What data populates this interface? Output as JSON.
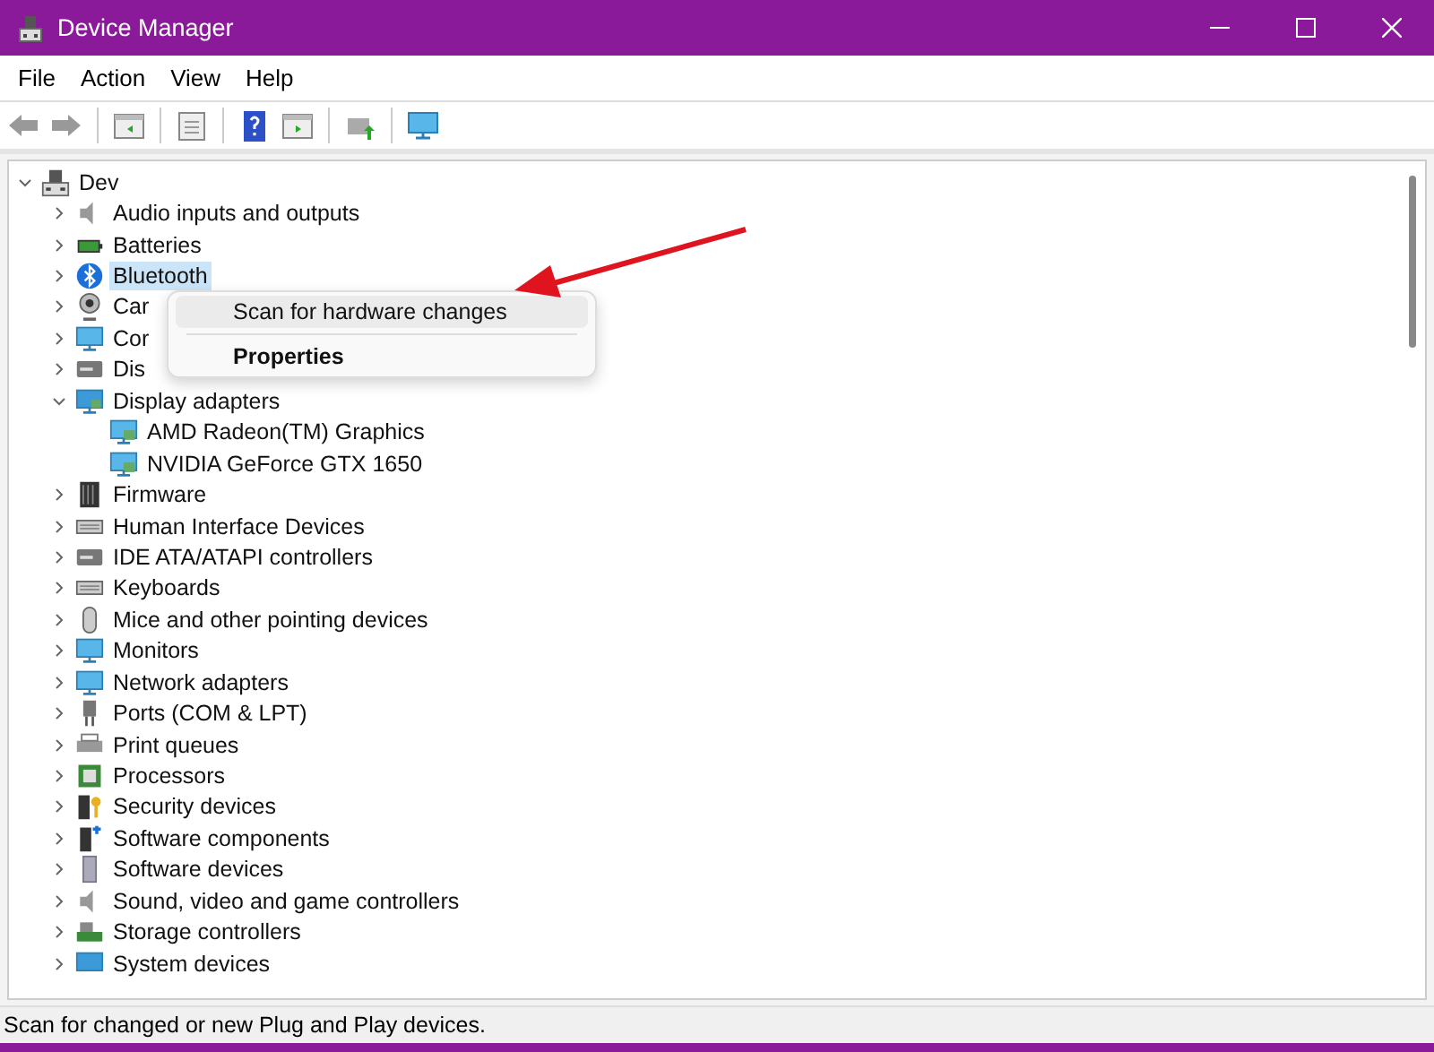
{
  "window": {
    "title": "Device Manager"
  },
  "menu_bar": [
    "File",
    "Action",
    "View",
    "Help"
  ],
  "tree": {
    "label": "Dev",
    "expanded": true,
    "selected": false,
    "children": [
      {
        "label": "Audio inputs and outputs",
        "expanded": false,
        "selected": false
      },
      {
        "label": "Batteries",
        "expanded": false,
        "selected": false
      },
      {
        "label": "Bluetooth",
        "expanded": false,
        "selected": true
      },
      {
        "label": "Car",
        "expanded": false,
        "selected": false
      },
      {
        "label": "Cor",
        "expanded": false,
        "selected": false
      },
      {
        "label": "Dis",
        "expanded": false,
        "selected": false
      },
      {
        "label": "Display adapters",
        "expanded": true,
        "selected": false,
        "children": [
          {
            "label": "AMD Radeon(TM) Graphics",
            "selected": false
          },
          {
            "label": "NVIDIA GeForce GTX 1650",
            "selected": false
          }
        ]
      },
      {
        "label": "Firmware",
        "expanded": false,
        "selected": false
      },
      {
        "label": "Human Interface Devices",
        "expanded": false,
        "selected": false
      },
      {
        "label": "IDE ATA/ATAPI controllers",
        "expanded": false,
        "selected": false
      },
      {
        "label": "Keyboards",
        "expanded": false,
        "selected": false
      },
      {
        "label": "Mice and other pointing devices",
        "expanded": false,
        "selected": false
      },
      {
        "label": "Monitors",
        "expanded": false,
        "selected": false
      },
      {
        "label": "Network adapters",
        "expanded": false,
        "selected": false
      },
      {
        "label": "Ports (COM & LPT)",
        "expanded": false,
        "selected": false
      },
      {
        "label": "Print queues",
        "expanded": false,
        "selected": false
      },
      {
        "label": "Processors",
        "expanded": false,
        "selected": false
      },
      {
        "label": "Security devices",
        "expanded": false,
        "selected": false
      },
      {
        "label": "Software components",
        "expanded": false,
        "selected": false
      },
      {
        "label": "Software devices",
        "expanded": false,
        "selected": false
      },
      {
        "label": "Sound, video and game controllers",
        "expanded": false,
        "selected": false
      },
      {
        "label": "Storage controllers",
        "expanded": false,
        "selected": false
      },
      {
        "label": "System devices",
        "expanded": false,
        "selected": false
      }
    ]
  },
  "context_menu": {
    "items": [
      {
        "kind": "item",
        "label": "Scan for hardware changes",
        "selected": true
      },
      {
        "kind": "separator"
      },
      {
        "kind": "default",
        "label": "Properties",
        "selected": false
      }
    ]
  },
  "status_bar": "Scan for changed or new Plug and Play devices."
}
